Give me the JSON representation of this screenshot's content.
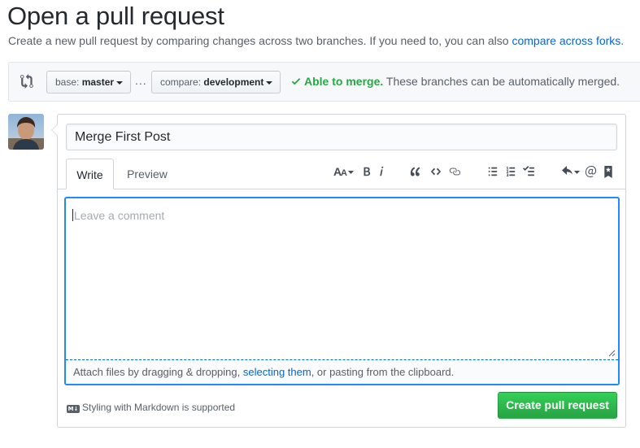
{
  "page": {
    "title": "Open a pull request",
    "subtitle": "Create a new pull request by comparing changes across two branches. If you need to, you can also ",
    "subtitle_link": "compare across forks",
    "subtitle_end": "."
  },
  "range": {
    "base_prefix": "base: ",
    "base_branch": "master",
    "separator": "...",
    "compare_prefix": "compare: ",
    "compare_branch": "development",
    "merge_ok": "Able to merge.",
    "merge_detail": " These branches can be automatically merged."
  },
  "form": {
    "title_value": "Merge First Post",
    "tabs": [
      {
        "label": "Write"
      },
      {
        "label": "Preview"
      }
    ],
    "toolbar_icons": [
      "text-size-icon",
      "bold-icon",
      "italic-icon",
      "quote-icon",
      "code-icon",
      "link-icon",
      "bullet-list-icon",
      "numbered-list-icon",
      "task-list-icon",
      "reply-icon",
      "mention-icon",
      "bookmark-icon"
    ],
    "comment_placeholder": "Leave a comment",
    "attach_prefix": "Attach files by dragging & dropping, ",
    "attach_link": "selecting them",
    "attach_suffix": ", or pasting from the clipboard.",
    "markdown_badge": "M↓",
    "markdown_note": "Styling with Markdown is supported",
    "submit_label": "Create pull request"
  },
  "colors": {
    "accent": "#0366d6",
    "success": "#28a745",
    "focus_border": "#2188ff"
  }
}
